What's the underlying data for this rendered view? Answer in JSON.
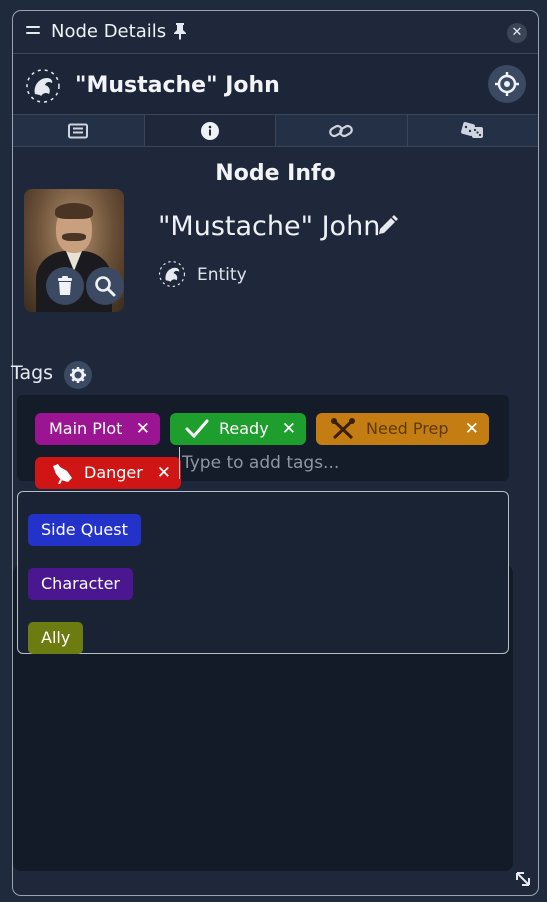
{
  "titlebar": {
    "title": "Node Details"
  },
  "header": {
    "name": "\"Mustache\" John"
  },
  "tabs": [
    "info-book-icon",
    "info-icon",
    "link-icon",
    "dice-icon"
  ],
  "section": {
    "title": "Node Info"
  },
  "node": {
    "name": "\"Mustache\" John",
    "type": "Entity"
  },
  "tags": {
    "label": "Tags",
    "items": [
      {
        "label": "Main Plot",
        "color": "#9b1593"
      },
      {
        "label": "Ready",
        "color": "#1e9e2c",
        "icon": "check-icon"
      },
      {
        "label": "Need Prep",
        "color": "#c47d12",
        "icon": "tools-icon"
      },
      {
        "label": "Danger",
        "color": "#d01515",
        "icon": "rooster-icon"
      }
    ],
    "input_placeholder": "Type to add tags..."
  },
  "suggestions": [
    {
      "label": "Side Quest",
      "color": "#2333c9"
    },
    {
      "label": "Character",
      "color": "#4b1790"
    },
    {
      "label": "Ally",
      "color": "#6d7c10"
    }
  ]
}
